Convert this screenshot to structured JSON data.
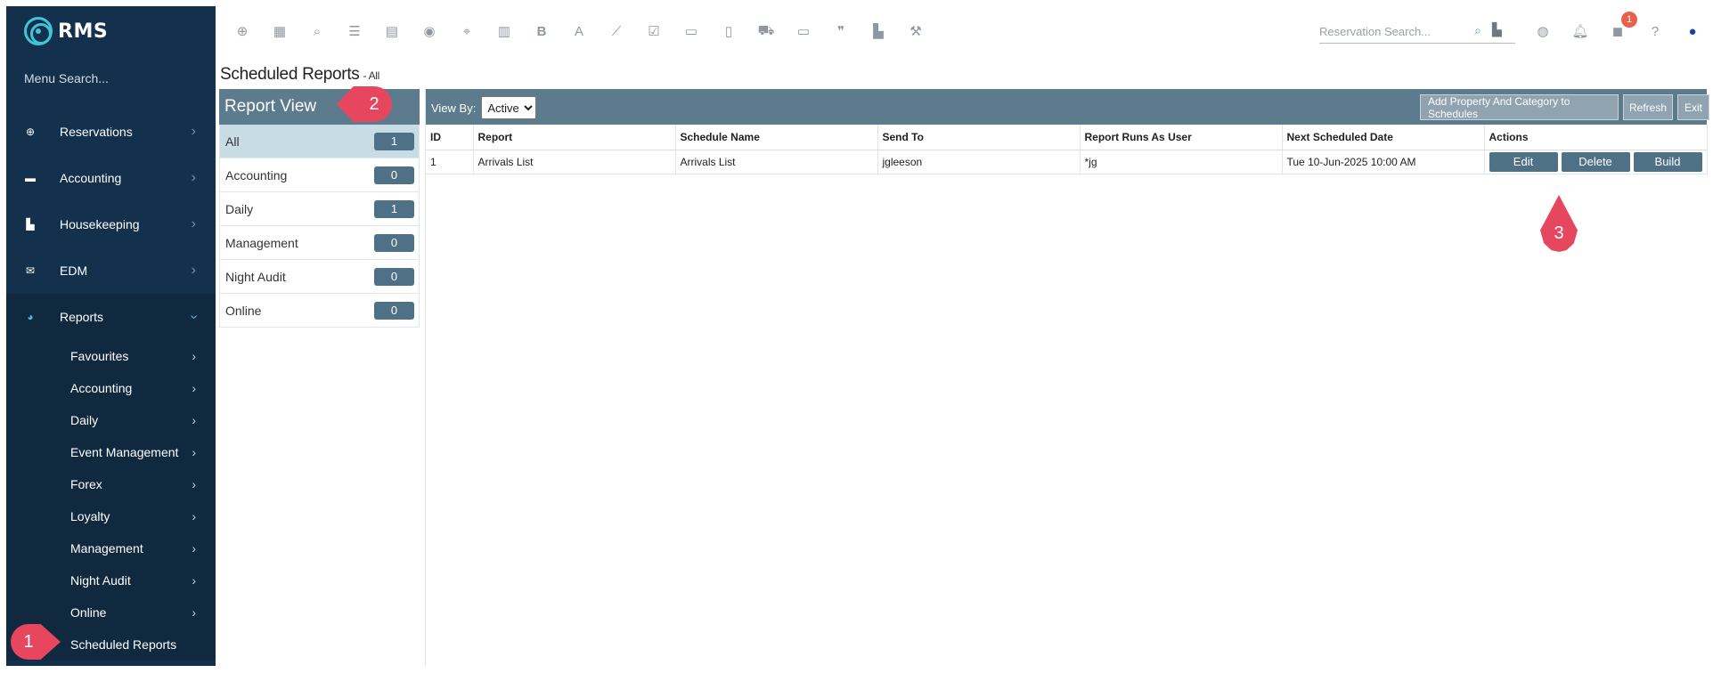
{
  "app": {
    "logo_text": "RMS",
    "menu_search_placeholder": "Menu Search..."
  },
  "sidebar": {
    "items": [
      {
        "label": "Reservations",
        "icon": "plus-circle-icon"
      },
      {
        "label": "Accounting",
        "icon": "cash-icon"
      },
      {
        "label": "Housekeeping",
        "icon": "bed-icon"
      },
      {
        "label": "EDM",
        "icon": "envelope-icon"
      },
      {
        "label": "Reports",
        "icon": "pie-chart-icon",
        "expanded": true
      }
    ],
    "report_subitems": [
      {
        "label": "Favourites"
      },
      {
        "label": "Accounting"
      },
      {
        "label": "Daily"
      },
      {
        "label": "Event Management"
      },
      {
        "label": "Forex"
      },
      {
        "label": "Loyalty"
      },
      {
        "label": "Management"
      },
      {
        "label": "Night Audit"
      },
      {
        "label": "Online"
      },
      {
        "label": "Scheduled Reports",
        "active": true
      }
    ]
  },
  "topbar": {
    "tools": [
      "add-circle-icon",
      "calendar-icon",
      "search-icon",
      "sliders-icon",
      "grid-icon",
      "users-icon",
      "map-marker-icon",
      "map-icon",
      "bold-b-icon",
      "letter-a-icon",
      "line-chart-icon",
      "checklist-icon",
      "id-card-icon",
      "document-icon",
      "cart-icon",
      "ticket-icon",
      "quote-icon",
      "bed-icon",
      "hammer-icon"
    ],
    "reservation_search_placeholder": "Reservation Search...",
    "right_icons": [
      "globe-icon",
      "bell-icon",
      "chat-icon",
      "help-icon",
      "user-icon"
    ],
    "notification_count": "1"
  },
  "page": {
    "title": "Scheduled Reports",
    "title_suffix": "- All"
  },
  "report_view": {
    "header": "Report View",
    "categories": [
      {
        "label": "All",
        "count": "1",
        "selected": true
      },
      {
        "label": "Accounting",
        "count": "0"
      },
      {
        "label": "Daily",
        "count": "1"
      },
      {
        "label": "Management",
        "count": "0"
      },
      {
        "label": "Night Audit",
        "count": "0"
      },
      {
        "label": "Online",
        "count": "0"
      }
    ]
  },
  "main": {
    "view_by_label": "View By:",
    "view_by_value": "Active",
    "buttons": {
      "add_property": "Add Property And Category to Schedules",
      "refresh": "Refresh",
      "exit": "Exit"
    },
    "table": {
      "columns": [
        "ID",
        "Report",
        "Schedule Name",
        "Send To",
        "Report Runs As User",
        "Next Scheduled Date",
        "Actions"
      ],
      "rows": [
        {
          "id": "1",
          "report": "Arrivals List",
          "schedule_name": "Arrivals List",
          "send_to": "jgleeson",
          "runs_as": "*jg",
          "next_date": "Tue 10-Jun-2025 10:00 AM"
        }
      ],
      "action_labels": {
        "edit": "Edit",
        "delete": "Delete",
        "build": "Build"
      }
    }
  },
  "annotations": {
    "marker_1": "1",
    "marker_2": "2",
    "marker_3": "3",
    "color": "#e6475f"
  }
}
